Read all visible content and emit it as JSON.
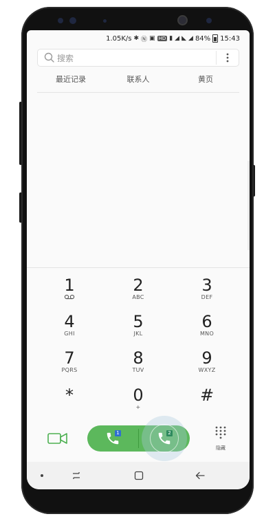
{
  "status_bar": {
    "speed": "1.05K/s",
    "hd": "HD",
    "battery": "84%",
    "time": "15:43"
  },
  "search": {
    "placeholder": "搜索"
  },
  "tabs": [
    {
      "label": "最近记录"
    },
    {
      "label": "联系人"
    },
    {
      "label": "黄页"
    }
  ],
  "keypad": [
    {
      "digit": "1",
      "letters": ""
    },
    {
      "digit": "2",
      "letters": "ABC"
    },
    {
      "digit": "3",
      "letters": "DEF"
    },
    {
      "digit": "4",
      "letters": "GHI"
    },
    {
      "digit": "5",
      "letters": "JKL"
    },
    {
      "digit": "6",
      "letters": "MNO"
    },
    {
      "digit": "7",
      "letters": "PQRS"
    },
    {
      "digit": "8",
      "letters": "TUV"
    },
    {
      "digit": "9",
      "letters": "WXYZ"
    },
    {
      "digit": "*",
      "letters": ""
    },
    {
      "digit": "0",
      "letters": "+"
    },
    {
      "digit": "#",
      "letters": ""
    }
  ],
  "call_buttons": {
    "sim1_badge": "1",
    "sim2_badge": "2"
  },
  "hide_label": "隐藏",
  "icons": {
    "video": "video-call-icon",
    "call": "phone-icon",
    "voicemail": "voicemail-icon",
    "search": "search-icon",
    "more": "more-vertical-icon",
    "dialpad": "dialpad-icon"
  },
  "colors": {
    "call_green": "#5cb85c",
    "video_green": "#4caf50",
    "sim1": "#2f6fd0",
    "sim2": "#2f8a5e"
  }
}
